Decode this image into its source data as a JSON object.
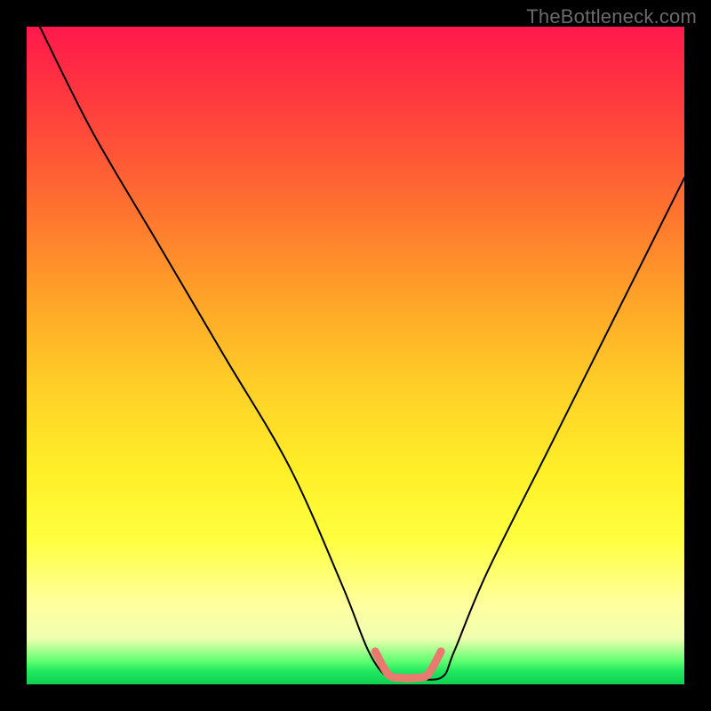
{
  "watermark": "TheBottleneck.com",
  "chart_data": {
    "type": "line",
    "title": "",
    "xlabel": "",
    "ylabel": "",
    "xlim": [
      0,
      100
    ],
    "ylim": [
      0,
      100
    ],
    "series": [
      {
        "name": "bottleneck-curve",
        "x": [
          2,
          10,
          20,
          30,
          40,
          48,
          52,
          55,
          58,
          63,
          65,
          70,
          80,
          90,
          100
        ],
        "values": [
          100,
          84,
          67,
          50,
          33,
          15,
          5,
          1,
          1,
          1,
          5,
          17,
          37,
          57,
          77
        ]
      },
      {
        "name": "optimal-band",
        "x": [
          53,
          55,
          57,
          59,
          61,
          63
        ],
        "values": [
          5,
          1.5,
          1,
          1,
          1.5,
          5
        ]
      }
    ],
    "annotations": []
  },
  "colors": {
    "curve": "#000000",
    "band": "#e87a70",
    "background_top": "#ff1a4d",
    "background_bottom": "#10d050"
  }
}
